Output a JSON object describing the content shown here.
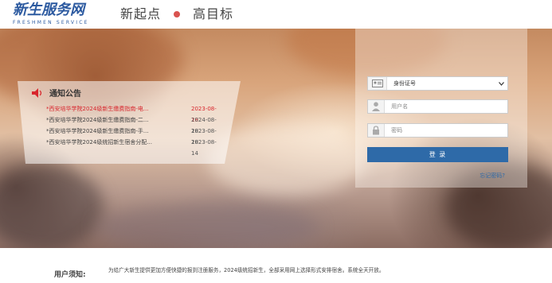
{
  "header": {
    "logo_main": "新生服务网",
    "logo_sub": "FRESHMEN SERVICE",
    "slogan_left": "新起点",
    "slogan_right": "高目标",
    "slogan_dot_color": "#d9534f"
  },
  "notice": {
    "title": "通知公告",
    "items": [
      {
        "title": "*西安培华学院2024级新生缴费指南-电...",
        "date": "2023-08-18",
        "highlighted": true
      },
      {
        "title": "*西安培华学院2024级新生缴费指南-二...",
        "date": "2024-08-18",
        "highlighted": false
      },
      {
        "title": "*西安培华学院2024级新生缴费指南-手...",
        "date": "2023-08-18",
        "highlighted": false
      },
      {
        "title": "*西安培华学院2024级统招新生宿舍分配...",
        "date": "2023-08-14",
        "highlighted": false
      }
    ]
  },
  "login": {
    "id_type_selected": "身份证号",
    "username_placeholder": "用户名",
    "password_placeholder": "密码",
    "submit_label": "登 录",
    "forgot_label": "忘记密码?"
  },
  "footer": {
    "label": "用户须知:",
    "text": "为给广大新生提供更加方便快捷的报到注册服务，2024级统招新生，全部采用网上选择形式安排宿舍。系统全天开放。"
  },
  "colors": {
    "brand_blue": "#2c5aa0",
    "login_button": "#2e6aa8",
    "highlight_red": "#d8262d"
  }
}
